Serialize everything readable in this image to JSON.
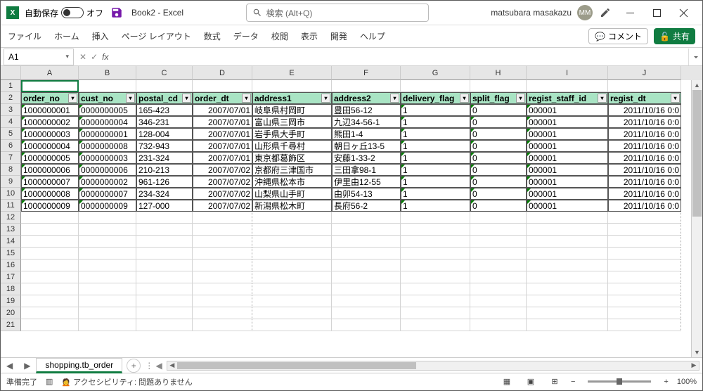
{
  "titlebar": {
    "autosave_label": "自動保存",
    "autosave_state": "オフ",
    "title": "Book2 - Excel",
    "search_placeholder": "検索 (Alt+Q)",
    "user_name": "matsubara masakazu",
    "user_initials": "MM"
  },
  "ribbon": {
    "tabs": [
      "ファイル",
      "ホーム",
      "挿入",
      "ページ レイアウト",
      "数式",
      "データ",
      "校閲",
      "表示",
      "開発",
      "ヘルプ"
    ],
    "comment": "コメント",
    "share": "共有"
  },
  "formula": {
    "name_box": "A1",
    "fx": "fx",
    "value": ""
  },
  "columns": [
    "A",
    "B",
    "C",
    "D",
    "E",
    "F",
    "G",
    "H",
    "I",
    "J"
  ],
  "col_widths": [
    "wA",
    "wB",
    "wC",
    "wD",
    "wE",
    "wF",
    "wG",
    "wH",
    "wI",
    "wJ"
  ],
  "row_numbers": [
    1,
    2,
    3,
    4,
    5,
    6,
    7,
    8,
    9,
    10,
    11,
    12,
    13,
    14,
    15,
    16,
    17,
    18,
    19,
    20,
    21
  ],
  "headers": [
    "order_no",
    "cust_no",
    "postal_cd",
    "order_dt",
    "address1",
    "address2",
    "delivery_flag",
    "split_flag",
    "regist_staff_id",
    "regist_dt"
  ],
  "data": [
    [
      "1000000001",
      "0000000005",
      "165-423",
      "2007/07/01",
      "岐阜県村岡町",
      "豊田56-12",
      "1",
      "0",
      "000001",
      "2011/10/16 0:0"
    ],
    [
      "1000000002",
      "0000000004",
      "346-231",
      "2007/07/01",
      "富山県三岡市",
      "九辺34-56-1",
      "1",
      "0",
      "000001",
      "2011/10/16 0:0"
    ],
    [
      "1000000003",
      "0000000001",
      "128-004",
      "2007/07/01",
      "岩手県大手町",
      "熊田1-4",
      "1",
      "0",
      "000001",
      "2011/10/16 0:0"
    ],
    [
      "1000000004",
      "0000000008",
      "732-943",
      "2007/07/01",
      "山形県千尋村",
      "朝日ヶ丘13-5",
      "1",
      "0",
      "000001",
      "2011/10/16 0:0"
    ],
    [
      "1000000005",
      "0000000003",
      "231-324",
      "2007/07/01",
      "東京都葛飾区",
      "安藤1-33-2",
      "1",
      "0",
      "000001",
      "2011/10/16 0:0"
    ],
    [
      "1000000006",
      "0000000006",
      "210-213",
      "2007/07/02",
      "京都府三津国市",
      "三田拿98-1",
      "1",
      "0",
      "000001",
      "2011/10/16 0:0"
    ],
    [
      "1000000007",
      "0000000002",
      "961-126",
      "2007/07/02",
      "沖縄県松本市",
      "伊里由12-55",
      "1",
      "0",
      "000001",
      "2011/10/16 0:0"
    ],
    [
      "1000000008",
      "0000000007",
      "234-324",
      "2007/07/02",
      "山梨県山手町",
      "由卯54-13",
      "1",
      "0",
      "000001",
      "2011/10/16 0:0"
    ],
    [
      "1000000009",
      "0000000009",
      "127-000",
      "2007/07/02",
      "新潟県松木町",
      "長府56-2",
      "1",
      "0",
      "000001",
      "2011/10/16 0:0"
    ]
  ],
  "sheet_tab": "shopping.tb_order",
  "statusbar": {
    "ready": "準備完了",
    "accessibility": "アクセシビリティ: 問題ありません",
    "zoom": "100%"
  }
}
